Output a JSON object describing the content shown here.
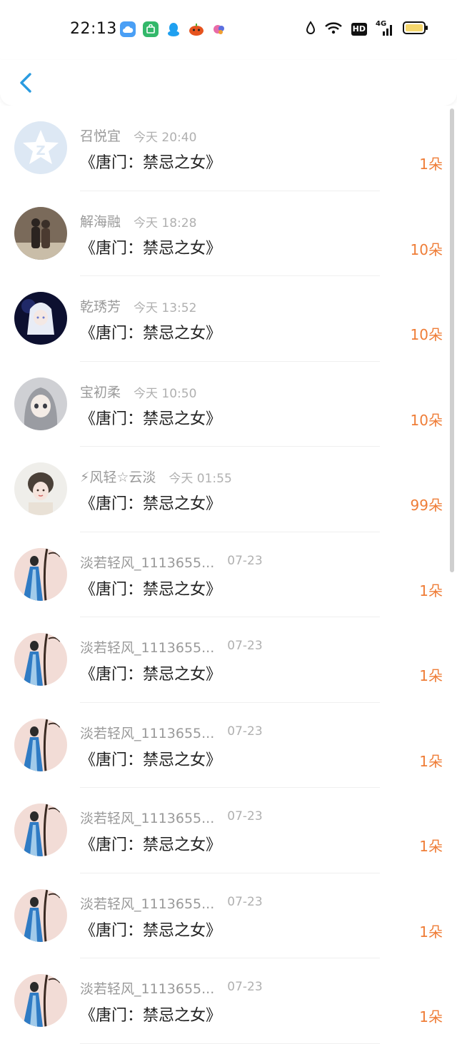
{
  "status_bar": {
    "time": "22:13",
    "app_icons": [
      "weather-icon",
      "store-icon",
      "qq-icon",
      "pumpkin-icon",
      "game-icon"
    ],
    "system_icons": [
      "drop-icon",
      "wifi-icon",
      "hd-icon",
      "4g-signal-icon",
      "battery-icon"
    ],
    "network_label": "4G",
    "hd_label": "HD"
  },
  "header": {
    "back_icon": "back-chevron-icon"
  },
  "colors": {
    "accent_blue": "#2a9be0",
    "count_orange": "#ef7d37"
  },
  "items": [
    {
      "name": "召悦宜",
      "date": "今天 20:40",
      "title": "《唐门：禁忌之女》",
      "count": "1朵",
      "avatar": "default-star-avatar"
    },
    {
      "name": "解海融",
      "date": "今天 18:28",
      "title": "《唐门：禁忌之女》",
      "count": "10朵",
      "avatar": "couple-photo-avatar"
    },
    {
      "name": "乾琇芳",
      "date": "今天 13:52",
      "title": "《唐门：禁忌之女》",
      "count": "10朵",
      "avatar": "anime-dark-avatar"
    },
    {
      "name": "宝初柔",
      "date": "今天 10:50",
      "title": "《唐门：禁忌之女》",
      "count": "10朵",
      "avatar": "anime-girl-avatar"
    },
    {
      "name": "⚡风轻☆云淡",
      "date": "今天 01:55",
      "title": "《唐门：禁忌之女》",
      "count": "99朵",
      "avatar": "painted-girl-avatar"
    },
    {
      "name": "淡若轻风_1113655...",
      "date": "07-23",
      "title": "《唐门：禁忌之女》",
      "count": "1朵",
      "avatar": "blue-dress-avatar"
    },
    {
      "name": "淡若轻风_1113655...",
      "date": "07-23",
      "title": "《唐门：禁忌之女》",
      "count": "1朵",
      "avatar": "blue-dress-avatar"
    },
    {
      "name": "淡若轻风_1113655...",
      "date": "07-23",
      "title": "《唐门：禁忌之女》",
      "count": "1朵",
      "avatar": "blue-dress-avatar"
    },
    {
      "name": "淡若轻风_1113655...",
      "date": "07-23",
      "title": "《唐门：禁忌之女》",
      "count": "1朵",
      "avatar": "blue-dress-avatar"
    },
    {
      "name": "淡若轻风_1113655...",
      "date": "07-23",
      "title": "《唐门：禁忌之女》",
      "count": "1朵",
      "avatar": "blue-dress-avatar"
    },
    {
      "name": "淡若轻风_1113655...",
      "date": "07-23",
      "title": "《唐门：禁忌之女》",
      "count": "1朵",
      "avatar": "blue-dress-avatar"
    }
  ]
}
